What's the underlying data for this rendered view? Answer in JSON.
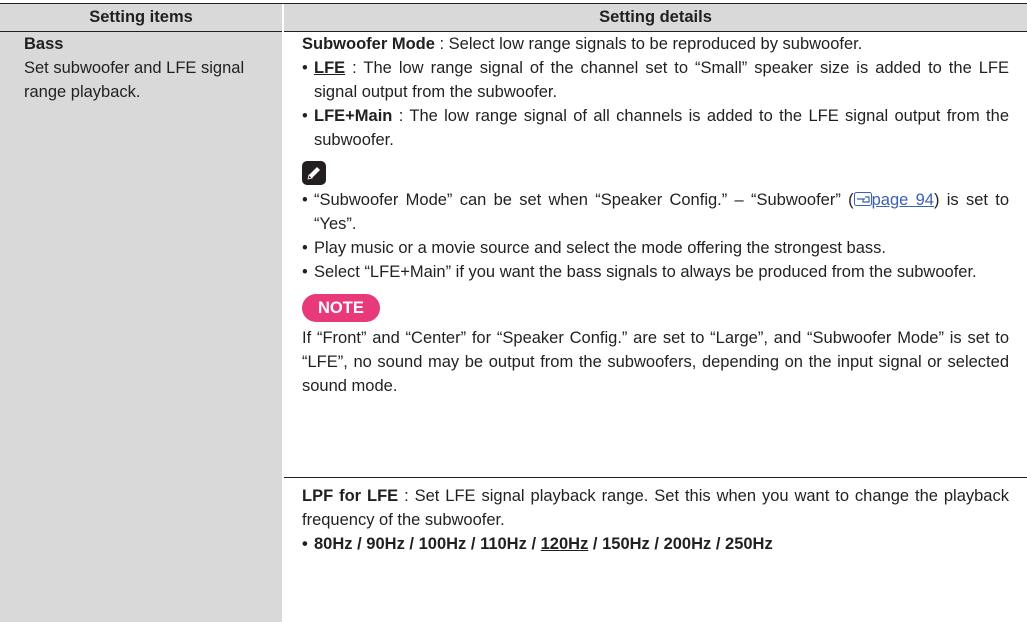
{
  "header": {
    "col1": "Setting items",
    "col2": "Setting details"
  },
  "item": {
    "title": "Bass",
    "desc": "Set subwoofer and LFE signal range playback."
  },
  "subwoofer": {
    "label": "Subwoofer Mode",
    "text": " : Select low range signals to be reproduced by subwoofer.",
    "opt1_label": "LFE",
    "opt1_text": " : The low range signal of the channel set to “Small” speaker size is added to the LFE signal output from the subwoofer.",
    "opt2_label": "LFE+Main",
    "opt2_text": " : The low range signal of all channels is added to the LFE signal output from the subwoofer.",
    "memo1_a": "“Subwoofer Mode” can be set when “Speaker Config.” – “Subwoofer” (",
    "memo1_link": "page 94",
    "memo1_b": ") is set to “Yes”.",
    "memo2": "Play music or a movie source and select the mode offering the strongest bass.",
    "memo3": "Select “LFE+Main” if you want the bass signals to always be produced from the subwoofer.",
    "note_label": "NOTE",
    "note_text": "If “Front” and “Center” for “Speaker Config.” are set to “Large”, and “Subwoofer Mode” is set to “LFE”, no sound may be output from the subwoofers, depending on the input signal or selected sound mode."
  },
  "lpf": {
    "label": "LPF for LFE",
    "text": " : Set LFE signal playback range. Set this when you want to change the playback frequency of the subwoofer.",
    "options": [
      "80Hz",
      "90Hz",
      "100Hz",
      "110Hz",
      "120Hz",
      "150Hz",
      "200Hz",
      "250Hz"
    ],
    "default_option": "120Hz"
  },
  "colors": {
    "header_bg": "#d9d9d9",
    "note_badge": "#e8397a",
    "link": "#3b5fb3"
  },
  "icons": {
    "memo": "pencil-icon",
    "reference": "hand-pointer-icon"
  }
}
